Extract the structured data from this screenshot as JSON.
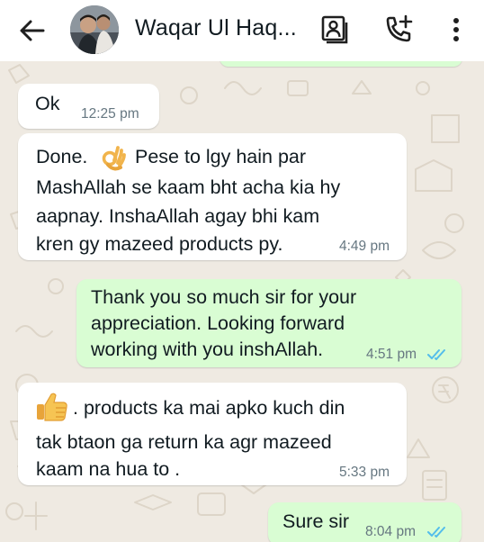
{
  "header": {
    "contact_name": "Waqar Ul Haq...",
    "icons": [
      "back-arrow-icon",
      "contact-card-icon",
      "add-call-icon",
      "more-vert-icon"
    ]
  },
  "messages": [
    {
      "direction": "incoming",
      "lines": [
        "Ok"
      ],
      "time": "12:25 pm"
    },
    {
      "direction": "incoming",
      "lines": [
        "Done.",
        "Pese to lgy hain par",
        "MashAllah se kaam bht acha kia hy",
        "aapnay. InshaAllah agay bhi kam",
        "kren gy mazeed products py."
      ],
      "emoji": "ok-hand-emoji",
      "time": "4:49 pm"
    },
    {
      "direction": "outgoing",
      "lines": [
        "Thank you so much sir for your",
        "appreciation. Looking forward",
        "working with you inshAllah."
      ],
      "time": "4:51 pm",
      "status": "read"
    },
    {
      "direction": "incoming",
      "lines": [
        ". products ka mai apko kuch din",
        "tak btaon ga return ka agr mazeed",
        "kaam na hua to ."
      ],
      "emoji": "thumbs-up-emoji",
      "time": "5:33 pm"
    },
    {
      "direction": "outgoing",
      "lines": [
        "Sure sir"
      ],
      "time": "8:04 pm",
      "status": "read"
    }
  ],
  "colors": {
    "chat_background": "#efeae2",
    "incoming_bubble": "#ffffff",
    "outgoing_bubble": "#d9fdd3",
    "read_ticks": "#53bdeb",
    "timestamp": "#667781",
    "text": "#111b21"
  }
}
